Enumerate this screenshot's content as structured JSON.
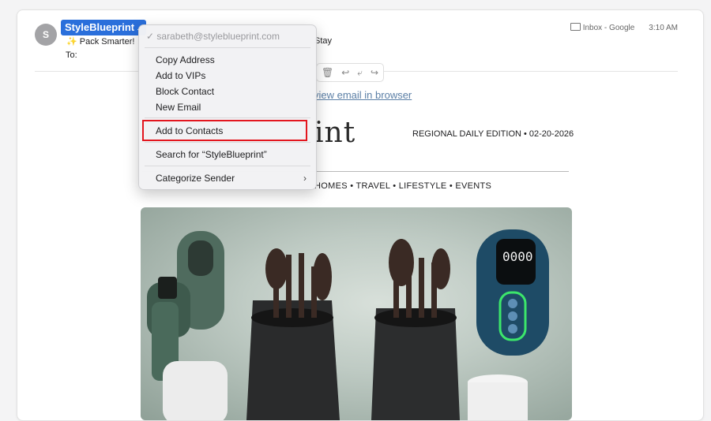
{
  "email": {
    "avatar_letter": "S",
    "sender_name": "StyleBlueprint",
    "subject_start": "✨ Pack Smarter!",
    "subject_end": "Stay",
    "to_label": "To:",
    "folder": "Inbox - Google",
    "time": "3:10 AM"
  },
  "newsletter": {
    "view_in_browser": "view email in browser",
    "logo_partial": "int",
    "edition": "REGIONAL DAILY EDITION  •  02-20-2026",
    "nav": "HOMES  •  TRAVEL  •  LIFESTYLE  •  EVENTS"
  },
  "context_menu": {
    "email_address": "sarabeth@styleblueprint.com",
    "items": [
      "Copy Address",
      "Add to VIPs",
      "Block Contact",
      "New Email",
      "Add to Contacts",
      "Search for “StyleBlueprint”",
      "Categorize Sender"
    ]
  },
  "colors": {
    "selection_blue": "#2a6fdb",
    "highlight_red": "#e3161f"
  }
}
